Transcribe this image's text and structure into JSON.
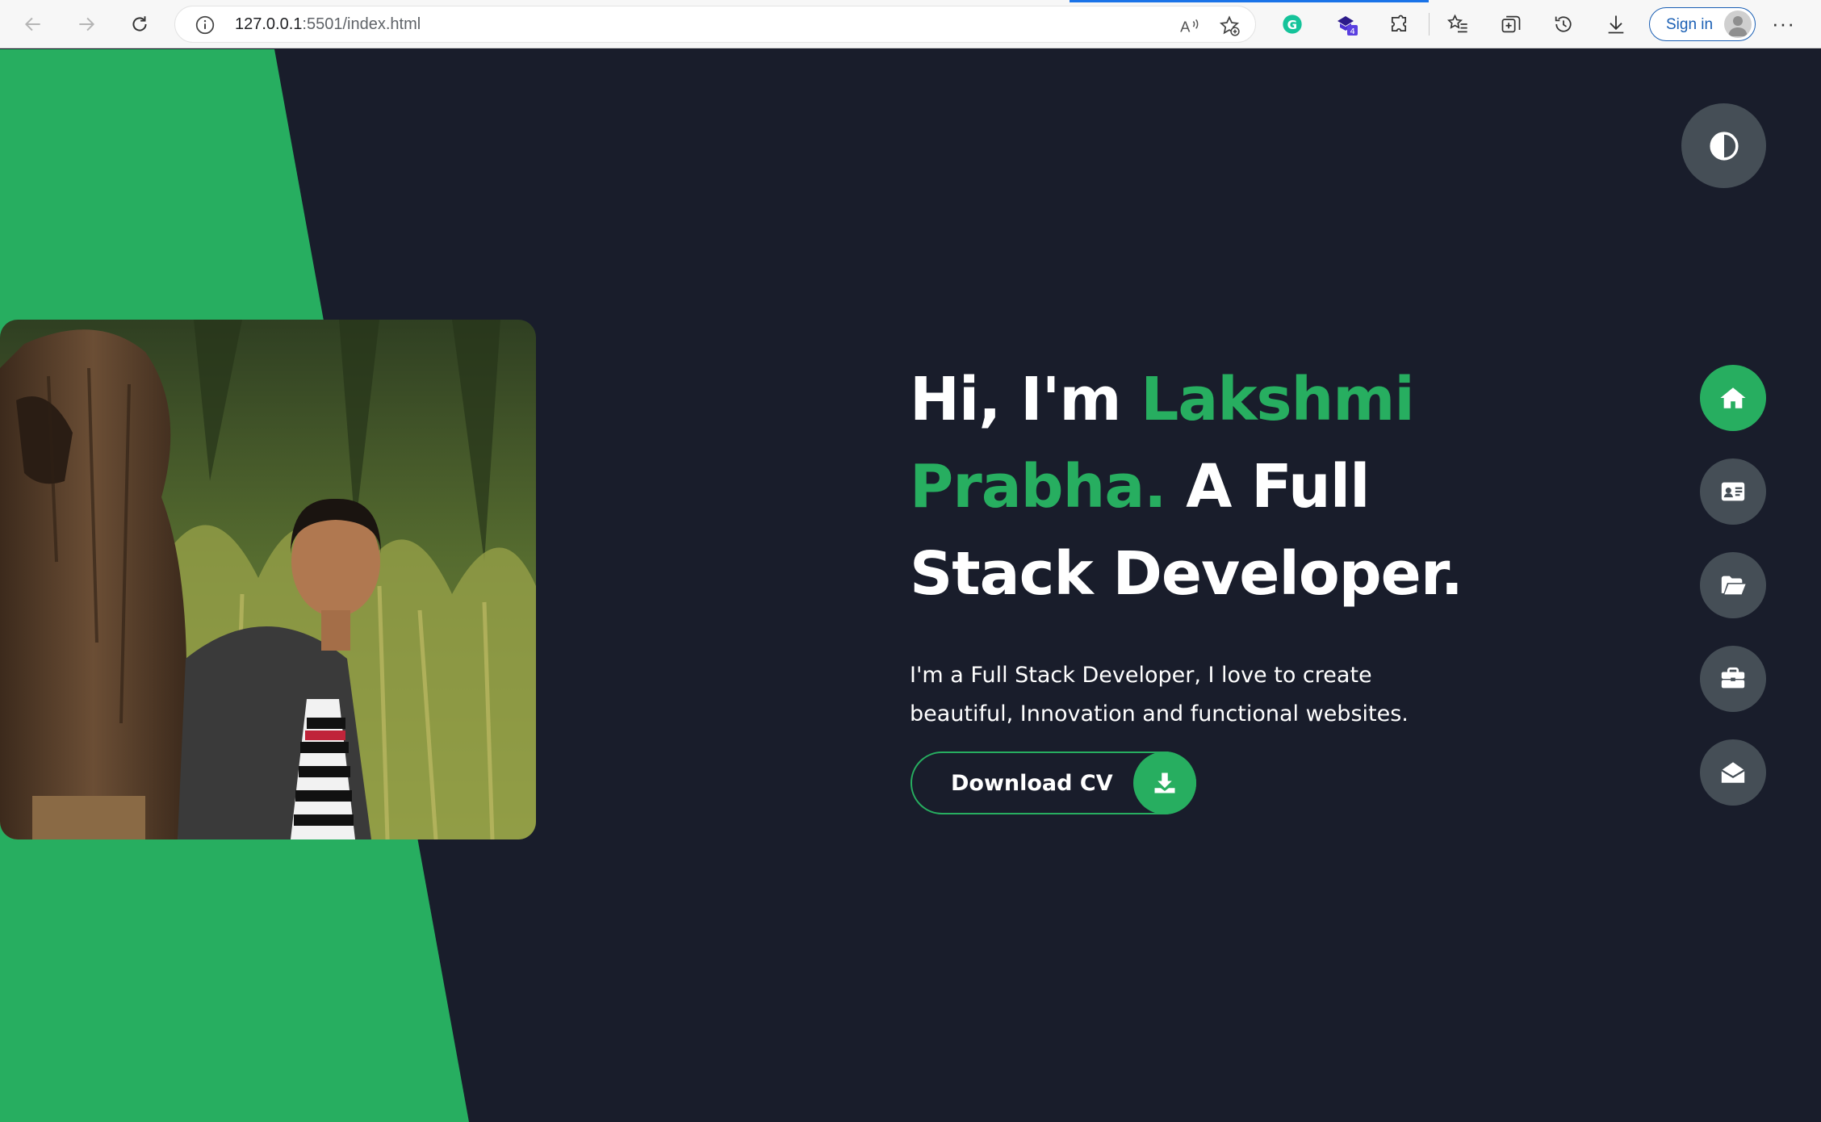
{
  "browser": {
    "url_host": "127.0.0.1",
    "url_rest": ":5501/index.html",
    "extension_badge": "4",
    "signin_label": "Sign in",
    "more_label": "···",
    "icons": [
      "back-icon",
      "forward-icon",
      "refresh-icon",
      "info-icon",
      "read-aloud-icon",
      "favorite-add-icon",
      "grammarly-icon",
      "extension-badge-icon",
      "extensions-icon",
      "favorites-icon",
      "collections-icon",
      "history-icon",
      "download-icon",
      "profile-avatar-icon",
      "more-icon"
    ]
  },
  "hero": {
    "greeting": "Hi, I'm ",
    "name": "Lakshmi Prabha.",
    "role": " A Full Stack Developer.",
    "description": "I'm a Full Stack Developer, I love to create beautiful, Innovation and functional websites.",
    "cta_label": "Download CV"
  },
  "controls": [
    {
      "name": "home",
      "icon": "home-icon",
      "active": true
    },
    {
      "name": "about",
      "icon": "id-card-icon",
      "active": false
    },
    {
      "name": "portfolio",
      "icon": "folder-open-icon",
      "active": false
    },
    {
      "name": "experience",
      "icon": "briefcase-icon",
      "active": false
    },
    {
      "name": "contact",
      "icon": "envelope-open-icon",
      "active": false
    }
  ],
  "colors": {
    "background": "#191d2b",
    "accent": "#27ae60",
    "control_bg": "#454e56",
    "text": "#ffffff"
  }
}
